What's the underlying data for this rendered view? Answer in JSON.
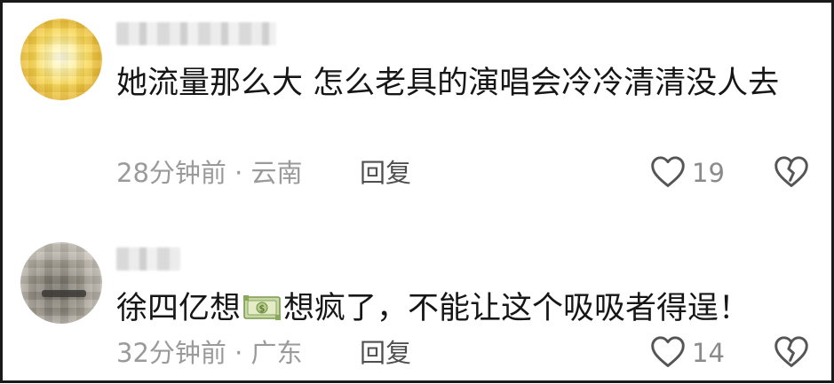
{
  "comments": [
    {
      "text": "她流量那么大 怎么老具的演唱会冷冷清清没人去",
      "time_location": "28分钟前 · 云南",
      "reply_label": "回复",
      "like_count": "19"
    },
    {
      "text_before_emoji": "徐四亿想",
      "emoji": "money-with-dollar-emoji",
      "text_after_emoji": "想疯了，不能让这个吸吸者得逞！",
      "time_location": "32分钟前 · 广东",
      "reply_label": "回复",
      "like_count": "14"
    }
  ],
  "icons": {
    "like": "heart-outline-icon",
    "dislike": "broken-heart-outline-icon"
  },
  "colors": {
    "text": "#161616",
    "meta": "#9a9a9a",
    "reply": "#4f4f4f",
    "icon": "#555555",
    "border": "#1a1a1a"
  }
}
